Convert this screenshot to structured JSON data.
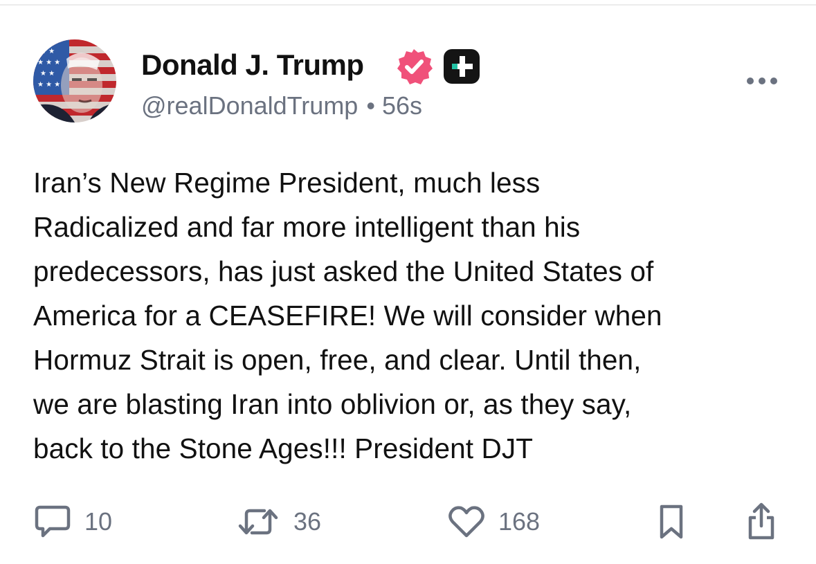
{
  "post": {
    "author": {
      "display_name": "Donald J. Trump",
      "handle": "@realDonaldTrump",
      "verified_icon": "verified-badge-icon",
      "badge_icon": "plus-badge-icon",
      "avatar_icon": "avatar"
    },
    "separator": "•",
    "timestamp": "56s",
    "more_icon": "more-horizontal-icon",
    "body": "Iran’s New Regime President, much less\nRadicalized and far more intelligent than his\npredecessors, has just asked the United States of\nAmerica for a CEASEFIRE! We will consider when\nHormuz Strait is open, free, and clear. Until then,\nwe are blasting Iran into oblivion or, as they say,\nback to the Stone Ages!!! President DJT",
    "actions": {
      "reply": {
        "icon": "reply-icon",
        "count": "10"
      },
      "repost": {
        "icon": "repost-icon",
        "count": "36"
      },
      "like": {
        "icon": "heart-icon",
        "count": "168"
      },
      "bookmark": {
        "icon": "bookmark-icon"
      },
      "share": {
        "icon": "share-icon"
      }
    }
  },
  "colors": {
    "text": "#111111",
    "muted": "#6b7280",
    "verified": "#f0517a",
    "badge_bg": "#141414",
    "badge_accent": "#22c3a5",
    "divider": "#ececec"
  }
}
